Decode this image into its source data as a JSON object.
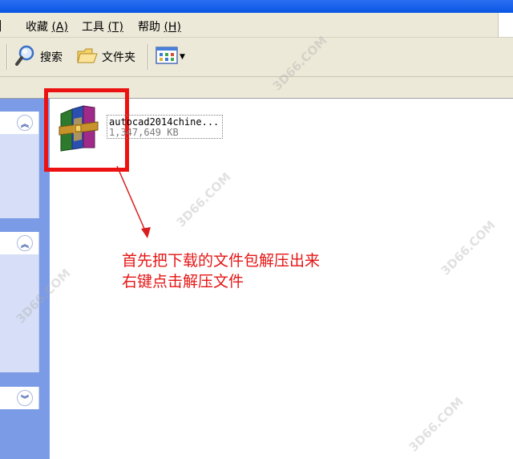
{
  "menu": {
    "items": [
      {
        "label": "收藏",
        "key": "(A)"
      },
      {
        "label": "工具",
        "key": "(T)"
      },
      {
        "label": "帮助",
        "key": "(H)"
      }
    ]
  },
  "toolbar": {
    "search_label": "搜索",
    "folders_label": "文件夹"
  },
  "file": {
    "name": "autocad2014chine...",
    "size": "1,347,649 KB"
  },
  "annotation": {
    "line1": "首先把下载的文件包解压出来",
    "line2": "右键点击解压文件"
  },
  "watermark": {
    "text": "3D66.COM"
  },
  "colors": {
    "highlight_red": "#ec1212",
    "annotation_red": "#e51515",
    "taskpane_blue": "#7b9be6"
  }
}
